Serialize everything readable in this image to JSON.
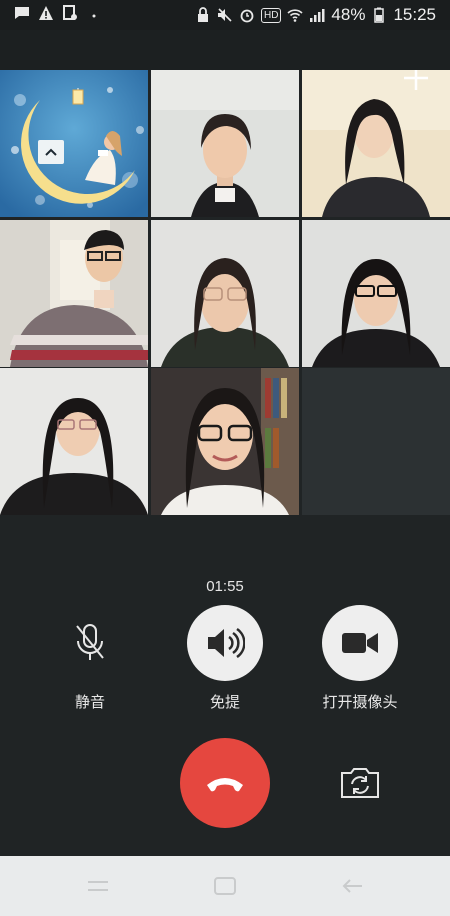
{
  "status_bar": {
    "battery": "48%",
    "time": "15:25",
    "hd_label": "HD"
  },
  "call": {
    "timer": "01:55",
    "mute_label": "静音",
    "speaker_label": "免提",
    "camera_label": "打开摄像头"
  },
  "icons": {
    "collapse": "chevron-up-icon",
    "add": "plus-icon",
    "mute": "microphone-off-icon",
    "speaker": "speaker-icon",
    "camera": "video-camera-icon",
    "hangup": "phone-hangup-icon",
    "switch_camera": "camera-switch-icon"
  },
  "colors": {
    "hangup": "#e5473f",
    "background": "#202425",
    "nav_bar": "#e9ebec"
  }
}
